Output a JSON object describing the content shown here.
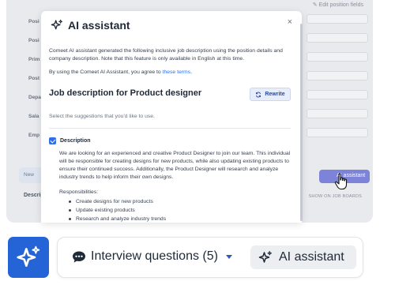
{
  "background": {
    "edit_fields": "Edit position fields",
    "labels": [
      "Posi",
      "Posi",
      "Prim",
      "Post",
      "Depa",
      "Sala",
      "Emp"
    ],
    "new_label": "New",
    "description_label": "Descript",
    "ai_button_label": "AI assistant",
    "show_label": "SHOW ON JOB BOARDS"
  },
  "modal": {
    "title": "AI assistant",
    "close_label": "×",
    "intro": "Comeet AI assistant generated the following inclusive job description using the position details and company description. Note that this feature is only available in English at this time.",
    "terms_prefix": "By using the Comeet AI Assistant, you agree to ",
    "terms_link": "these terms",
    "terms_suffix": ".",
    "heading": "Job description for Product designer",
    "rewrite_label": "Rewrite",
    "select_text": "Select the suggestions that you'd like to use.",
    "description_label": "Description",
    "description_checked": true,
    "description_body": "We are looking for an experienced and creative Product Designer to join our team. This individual will be responsible for creating designs for new products, while also updating existing products to ensure their continued success. Additionally, the Product Designer will research and analyze industry trends to help inform their own designs.",
    "responsibilities_label": "Responsibilities:",
    "responsibilities": [
      "Create designs for new products",
      "Update existing products",
      "Research and analyze industry trends"
    ]
  },
  "bottom_bar": {
    "interview_label": "Interview questions (5)",
    "ai_label": "AI assistant"
  },
  "colors": {
    "accent": "#2f6fed",
    "tile": "#2464d6",
    "ai_button": "#7c83d9"
  }
}
